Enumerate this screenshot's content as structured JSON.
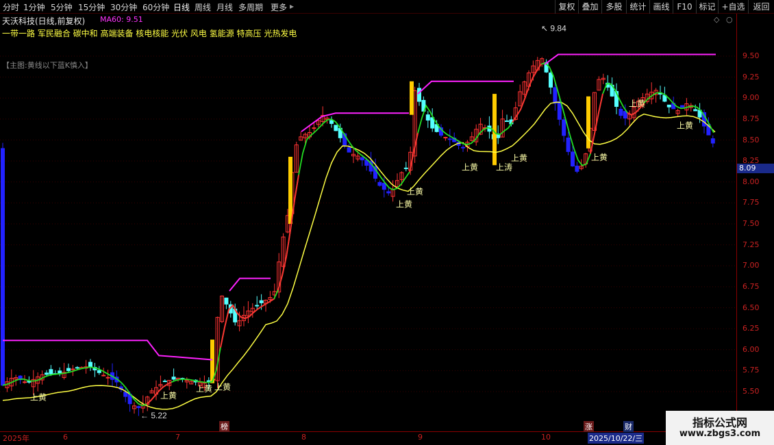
{
  "toolbar": {
    "periods": [
      "分时",
      "1分钟",
      "5分钟",
      "15分钟",
      "30分钟",
      "60分钟",
      "日线",
      "周线",
      "月线",
      "多周期",
      "更多"
    ],
    "active_period": "日线",
    "more_arrow": "▸",
    "right_buttons": [
      "复权",
      "叠加",
      "多股",
      "统计",
      "画线",
      "F10",
      "+自选",
      "返回"
    ],
    "mark_label": "标记"
  },
  "stock": {
    "title": "天沃科技(日线,前复权)",
    "ma_label": "MA60: 9.51",
    "concepts": "一带一路 军民融合 碳中和 高端装备 核电核能 光伏 风电 氢能源 特高压 光热发电",
    "main_note": "【主图:黄线以下蓝K慎入】"
  },
  "axis": {
    "price_labels": [
      "9.50",
      "9.25",
      "9.00",
      "8.75",
      "8.50",
      "8.25",
      "8.00",
      "7.75",
      "7.50",
      "7.25",
      "7.00",
      "6.75",
      "6.50",
      "6.25",
      "6.00",
      "5.75",
      "5.50"
    ],
    "current_price": "8.09"
  },
  "annotations": {
    "high": "9.84",
    "low": "5.22",
    "signal_label": "上黄",
    "signal_label_alt": "上涛"
  },
  "dates": {
    "labels": [
      "2025年",
      "6",
      "7",
      "8",
      "9",
      "10"
    ],
    "current_date": "2025/10/22/三",
    "markers": [
      "榜",
      "涨",
      "财"
    ]
  },
  "colors": {
    "up_red": "#ff3333",
    "down_cyan": "#55ffff",
    "blue_k": "#2222ff",
    "yellow_line": "#ffff44",
    "green_line": "#22dd22",
    "magenta_line": "#ff22ff",
    "signal_bar": "#ffcc00"
  },
  "watermark": {
    "title": "指标公式网",
    "url": "www.zbgs3.com"
  }
}
